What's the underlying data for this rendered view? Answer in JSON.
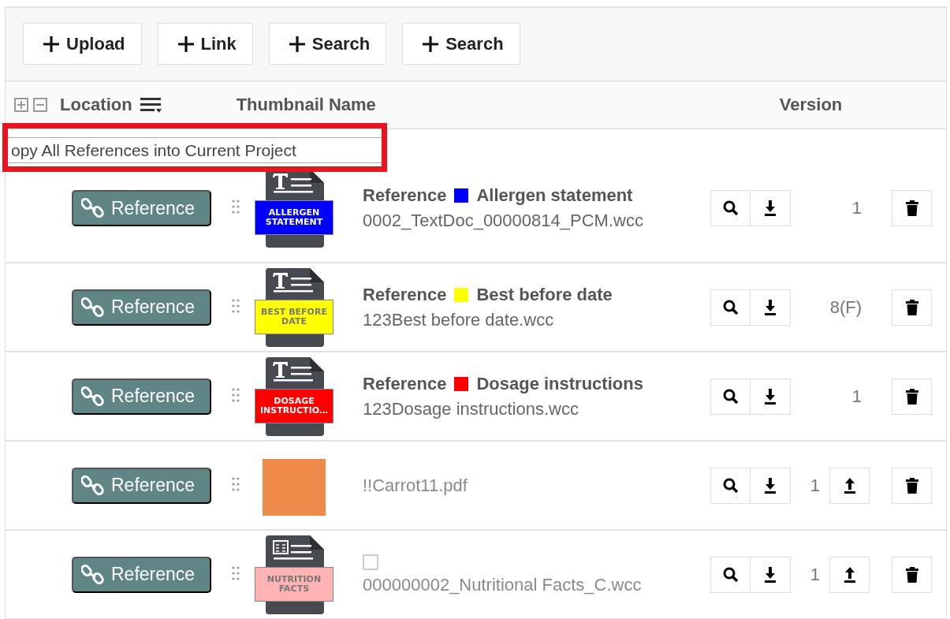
{
  "toolbar": {
    "buttons": [
      "Upload",
      "Link",
      "Search",
      "Search"
    ]
  },
  "table": {
    "columns": [
      "Location",
      "Thumbnail",
      "Name",
      "Version"
    ],
    "tooltip": "opy All References into Current Project",
    "rows": [
      {
        "location": "Reference",
        "thumbnail": {
          "kind": "text-doc",
          "color": "#0000ff",
          "label": [
            "ALLERGEN",
            "STATEMENT"
          ]
        },
        "title": {
          "prefix": "Reference",
          "color": "#0000ff",
          "label": "Allergen statement"
        },
        "file": "0002_TextDoc_00000814_PCM.wcc",
        "version": "1",
        "upload": false
      },
      {
        "location": "Reference",
        "thumbnail": {
          "kind": "text-doc",
          "color": "#ffff00",
          "label": [
            "BEST BEFORE",
            "DATE"
          ]
        },
        "title": {
          "prefix": "Reference",
          "color": "#ffff00",
          "label": "Best before date"
        },
        "file": "123Best before date.wcc",
        "version": "8(F)",
        "upload": false
      },
      {
        "location": "Reference",
        "thumbnail": {
          "kind": "text-doc",
          "color": "#ff0000",
          "label": [
            "DOSAGE",
            "INSTRUCTIO…"
          ]
        },
        "title": {
          "prefix": "Reference",
          "color": "#ff0000",
          "label": "Dosage instructions"
        },
        "file": "123Dosage instructions.wcc",
        "version": "1",
        "upload": false
      },
      {
        "location": "Reference",
        "thumbnail": {
          "kind": "photo"
        },
        "file": "!!Carrot11.pdf",
        "version": "1",
        "upload": true
      },
      {
        "location": "Reference",
        "thumbnail": {
          "kind": "table-doc",
          "color": "#ffb3b3",
          "label": [
            "NUTRITION",
            "FACTS"
          ]
        },
        "checkbox": {
          "checked": false
        },
        "file": "000000002_Nutritional Facts_C.wcc",
        "version": "1",
        "upload": true
      }
    ]
  }
}
